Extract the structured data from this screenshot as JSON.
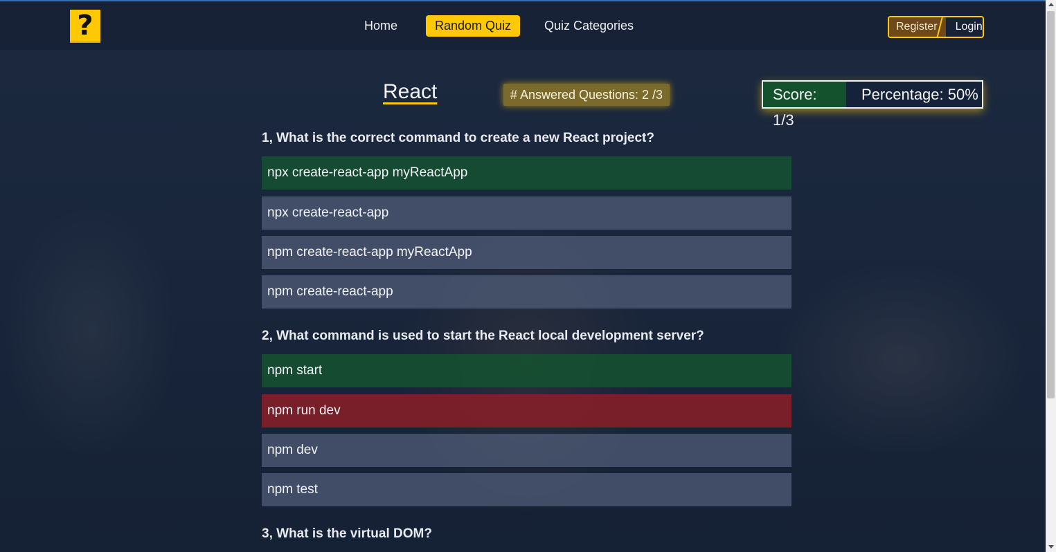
{
  "nav": {
    "logo_symbol": "?",
    "links": [
      "Home",
      "Random Quiz",
      "Quiz Categories"
    ],
    "active": "Random Quiz",
    "register": "Register",
    "login": "Login"
  },
  "quiz": {
    "title": "React",
    "answered": "# Answered Questions: 2 /3",
    "score": "Score: 1/3",
    "percentage": "Percentage: 50%",
    "questions": [
      {
        "text": "1, What is the correct command to create a new React project?",
        "options": [
          {
            "text": "npx create-react-app myReactApp",
            "state": "correct"
          },
          {
            "text": "npx create-react-app",
            "state": "none"
          },
          {
            "text": "npm create-react-app myReactApp",
            "state": "none"
          },
          {
            "text": "npm create-react-app",
            "state": "none"
          }
        ]
      },
      {
        "text": "2, What command is used to start the React local development server?",
        "options": [
          {
            "text": "npm start",
            "state": "correct"
          },
          {
            "text": "npm run dev",
            "state": "wrong"
          },
          {
            "text": "npm dev",
            "state": "none"
          },
          {
            "text": "npm test",
            "state": "none"
          }
        ]
      },
      {
        "text": "3, What is the virtual DOM?",
        "options": []
      }
    ]
  },
  "colors": {
    "accent": "#ffc805",
    "correct": "#14522d",
    "wrong": "#8a1e28",
    "navbar": "#172236"
  }
}
